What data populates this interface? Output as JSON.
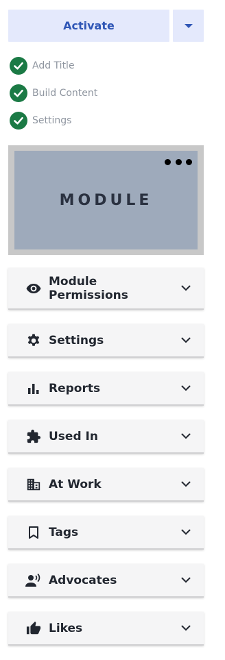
{
  "actions": {
    "activate_label": "Activate",
    "dropdown_icon": "caret-down-icon"
  },
  "steps": [
    {
      "label": "Add Title",
      "status": "complete"
    },
    {
      "label": "Build Content",
      "status": "complete"
    },
    {
      "label": "Settings",
      "status": "complete"
    }
  ],
  "module_card": {
    "title": "MODULE",
    "menu_icon": "more-horizontal-icon"
  },
  "panels": [
    {
      "label_line1": "Module",
      "label_line2": "Permissions",
      "icon": "eye-icon"
    },
    {
      "label": "Settings",
      "icon": "gear-icon"
    },
    {
      "label": "Reports",
      "icon": "bar-chart-icon"
    },
    {
      "label": "Used In",
      "icon": "puzzle-icon"
    },
    {
      "label": "At Work",
      "icon": "building-icon"
    },
    {
      "label": "Tags",
      "icon": "bookmark-icon"
    },
    {
      "label": "Advocates",
      "icon": "person-voice-icon"
    },
    {
      "label": "Likes",
      "icon": "thumbs-up-icon"
    }
  ],
  "colors": {
    "accent": "#2f56b6",
    "button_bg": "#e4e9fc",
    "check_green": "#1b7a45",
    "module_bg": "#9eaabb",
    "panel_bg": "#f5f5f6"
  }
}
